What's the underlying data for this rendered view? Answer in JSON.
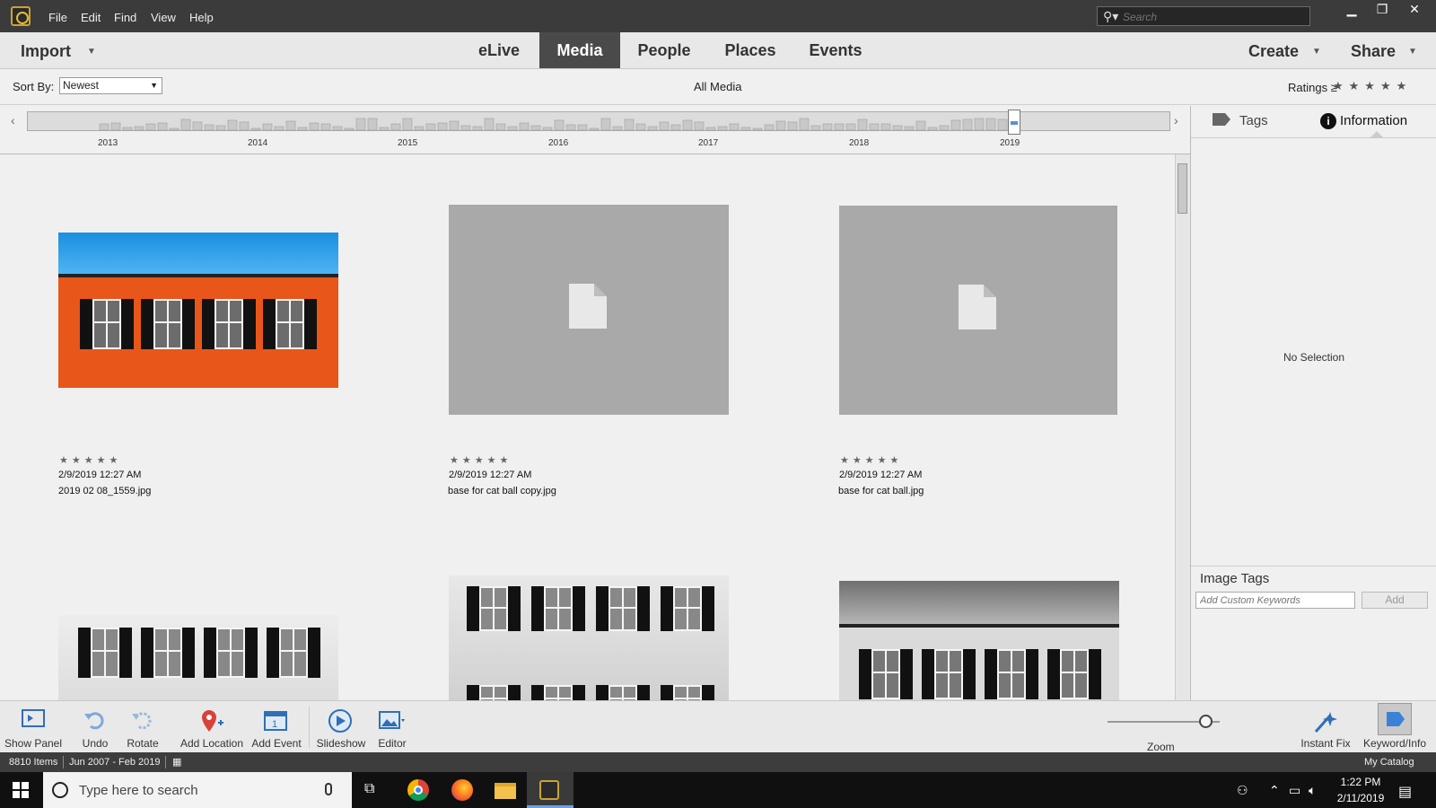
{
  "titlebar": {
    "menus": [
      "File",
      "Edit",
      "Find",
      "View",
      "Help"
    ],
    "search_placeholder": "Search"
  },
  "navbar": {
    "import_label": "Import",
    "tabs": [
      "eLive",
      "Media",
      "People",
      "Places",
      "Events"
    ],
    "active_tab": "Media",
    "create_label": "Create",
    "share_label": "Share"
  },
  "sortbar": {
    "sort_label": "Sort By:",
    "sort_value": "Newest",
    "view_label": "All Media",
    "ratings_label": "Ratings",
    "ratings_op": "≥",
    "ratings_stars": "★★★★★"
  },
  "timeline": {
    "years": [
      "2013",
      "2014",
      "2015",
      "2016",
      "2017",
      "2018",
      "2019"
    ]
  },
  "grid": {
    "items": [
      {
        "stars": "★★★★★",
        "date": "2/9/2019 12:27 AM",
        "filename": "2019 02 08_1559.jpg"
      },
      {
        "stars": "★★★★★",
        "date": "2/9/2019 12:27 AM",
        "filename": "base for cat ball copy.jpg"
      },
      {
        "stars": "★★★★★",
        "date": "2/9/2019 12:27 AM",
        "filename": "base for cat ball.jpg"
      }
    ]
  },
  "right_panel": {
    "tags_tab": "Tags",
    "info_tab": "Information",
    "info_icon_glyph": "i",
    "no_selection": "No Selection",
    "image_tags_label": "Image Tags",
    "keyword_placeholder": "Add Custom Keywords",
    "add_button": "Add"
  },
  "toolbar": {
    "show_panel": "Show Panel",
    "undo": "Undo",
    "rotate": "Rotate",
    "add_location": "Add Location",
    "add_event": "Add Event",
    "add_event_glyph": "1",
    "slideshow": "Slideshow",
    "editor": "Editor",
    "zoom": "Zoom",
    "instant_fix": "Instant Fix",
    "keyword_info": "Keyword/Info"
  },
  "statusbar": {
    "item_count": "8810 Items",
    "date_range": "Jun 2007 - Feb 2019",
    "catalog": "My Catalog"
  },
  "taskbar": {
    "search_text": "Type here to search",
    "time": "1:22 PM",
    "date": "2/11/2019"
  },
  "colors": {
    "titlebar": "#3b3b3b",
    "active_tab": "#4a4a4a",
    "brick": "#e8561a",
    "sky": "#1a8fe0",
    "placeholder": "#a9a9a9"
  }
}
